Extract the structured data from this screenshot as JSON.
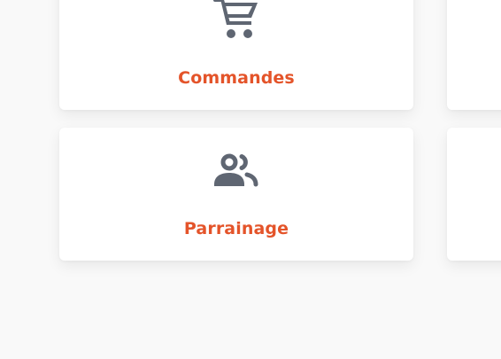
{
  "cards": [
    {
      "label": "Commandes",
      "icon": "shopping-cart-icon"
    },
    {
      "label": "Parrainage",
      "icon": "users-icon"
    }
  ],
  "colors": {
    "accent": "#E4542A",
    "icon": "#5F6672",
    "card_bg": "#FFFFFF",
    "page_bg": "#F9F9F9"
  }
}
